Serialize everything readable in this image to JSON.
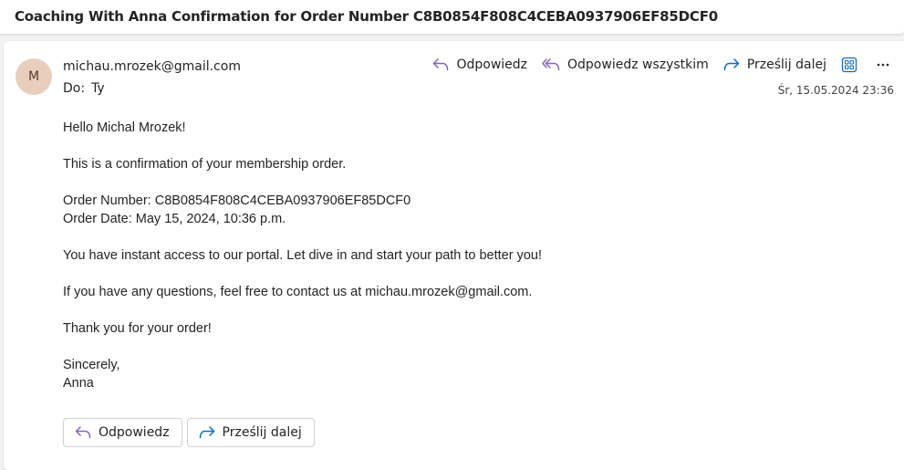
{
  "subject": "Coaching With Anna Confirmation for Order Number C8B0854F808C4CEBA0937906EF85DCF0",
  "message": {
    "avatar_initial": "M",
    "from": "michau.mrozek@gmail.com",
    "to_label": "Do:",
    "to_value": "Ty",
    "date": "Śr, 15.05.2024 23:36",
    "colors": {
      "avatar_bg": "#e8cfbd",
      "reply_icon": "#8764b8",
      "forward_icon": "#0f6cbd"
    }
  },
  "toolbar": {
    "reply_label": "Odpowiedz",
    "reply_all_label": "Odpowiedz wszystkim",
    "forward_label": "Prześlij dalej",
    "apps_icon": "apps-grid-icon",
    "more_icon": "more-horizontal-icon"
  },
  "body": {
    "greeting": "Hello Michal Mrozek!",
    "confirmation": "This is a confirmation of your membership order.",
    "order_number": "Order Number: C8B0854F808C4CEBA0937906EF85DCF0",
    "order_date": "Order Date: May 15, 2024, 10:36 p.m.",
    "access": "You have instant access to our portal. Let dive in and start your path to better you!",
    "questions": "If you have any questions, feel free to contact us at michau.mrozek@gmail.com.",
    "thanks": "Thank you for your order!",
    "closing": "Sincerely,",
    "signature": "Anna"
  },
  "footer": {
    "reply_label": "Odpowiedz",
    "forward_label": "Prześlij dalej"
  }
}
